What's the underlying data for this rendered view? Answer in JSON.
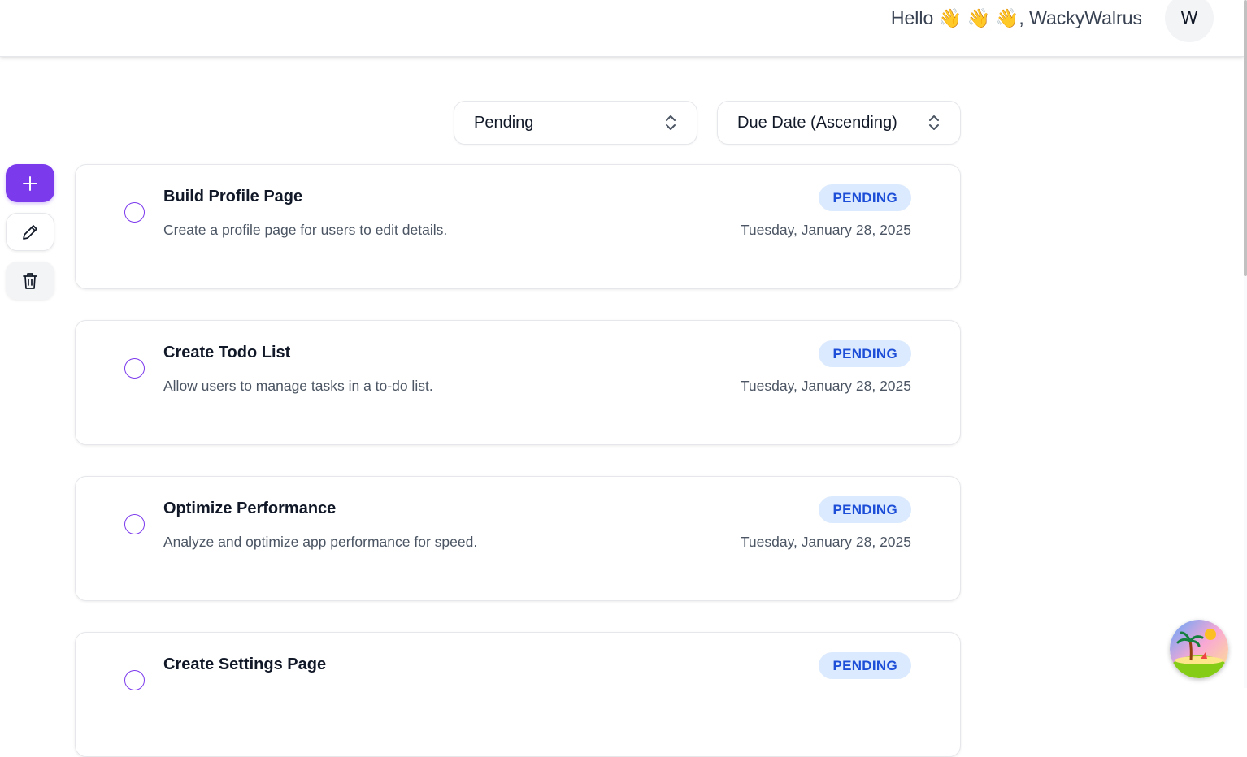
{
  "header": {
    "greeting": "Hello 👋 👋 👋, WackyWalrus",
    "avatar_initial": "W"
  },
  "filters": {
    "status_select": {
      "value": "Pending"
    },
    "sort_select": {
      "value": "Due Date (Ascending)"
    }
  },
  "sidebar": {
    "add_icon": "plus-icon",
    "edit_icon": "pencil-icon",
    "delete_icon": "trash-icon"
  },
  "tasks": [
    {
      "title": "Build Profile Page",
      "description": "Create a profile page for users to edit details.",
      "status": "PENDING",
      "due": "Tuesday, January 28, 2025"
    },
    {
      "title": "Create Todo List",
      "description": "Allow users to manage tasks in a to-do list.",
      "status": "PENDING",
      "due": "Tuesday, January 28, 2025"
    },
    {
      "title": "Optimize Performance",
      "description": "Analyze and optimize app performance for speed.",
      "status": "PENDING",
      "due": "Tuesday, January 28, 2025"
    },
    {
      "title": "Create Settings Page",
      "description": "",
      "status": "PENDING",
      "due": ""
    }
  ],
  "colors": {
    "accent": "#7c3aed",
    "badge_bg": "#dbeafe",
    "badge_text": "#1d4ed8"
  }
}
